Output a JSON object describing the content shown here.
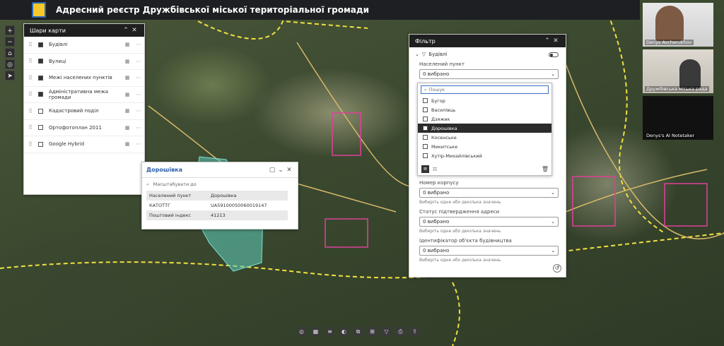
{
  "app": {
    "title": "Адресний реєстр Дружбівської міської територіальної громади"
  },
  "layers_panel": {
    "title": "Шари карти",
    "items": [
      {
        "label": "Будівлі",
        "checked": true
      },
      {
        "label": "Вулиці",
        "checked": true
      },
      {
        "label": "Межі населених пунктів",
        "checked": true
      },
      {
        "label": "Адміністративна межа громади",
        "checked": true
      },
      {
        "label": "Кадастровий поділ",
        "checked": false
      },
      {
        "label": "Ортофотоплан 2011",
        "checked": false
      },
      {
        "label": "Google Hybrid",
        "checked": false
      }
    ]
  },
  "popup": {
    "title": "Дорошівка",
    "search_placeholder": "Масштабувати до",
    "rows": [
      {
        "key": "Населений пункт",
        "value": "Дорошівка"
      },
      {
        "key": "КАТОТТГ",
        "value": "UA59100050060019147"
      },
      {
        "key": "Поштовий індекс",
        "value": "41213"
      }
    ]
  },
  "filter": {
    "title": "Фільтр",
    "section": "Будівлі",
    "settlement_label": "Населений пункт",
    "settlement_value": "0 вибрано",
    "search_placeholder": "Пошук",
    "options": [
      "Бугор",
      "Василівць",
      "Дзяжик",
      "Дорошівка",
      "Косенське",
      "Микитське",
      "Хутір-Михайлівський"
    ],
    "selected_option": "Дорошівка",
    "fields": [
      {
        "label": "Номер корпусу",
        "value": "0 вибрано",
        "hint": "Виберіть одне або декілька значень"
      },
      {
        "label": "Статус підтвердження адреси",
        "value": "0 вибрано",
        "hint": "Виберіть одне або декілька значень"
      },
      {
        "label": "Ідентифікатор об'єкта будівництва",
        "value": "0 вибрано",
        "hint": "Виберіть одне або декілька значень"
      }
    ]
  },
  "video": [
    {
      "name": "Denys Avcherukhov"
    },
    {
      "name": "Дружбівська міська рада"
    },
    {
      "name": "Denys's AI Notetaker"
    }
  ],
  "colors": {
    "accent": "#3a6fc2",
    "parcel_fill": "#5fd0c0",
    "road": "#e8d23a",
    "boundary": "#f0e040"
  }
}
